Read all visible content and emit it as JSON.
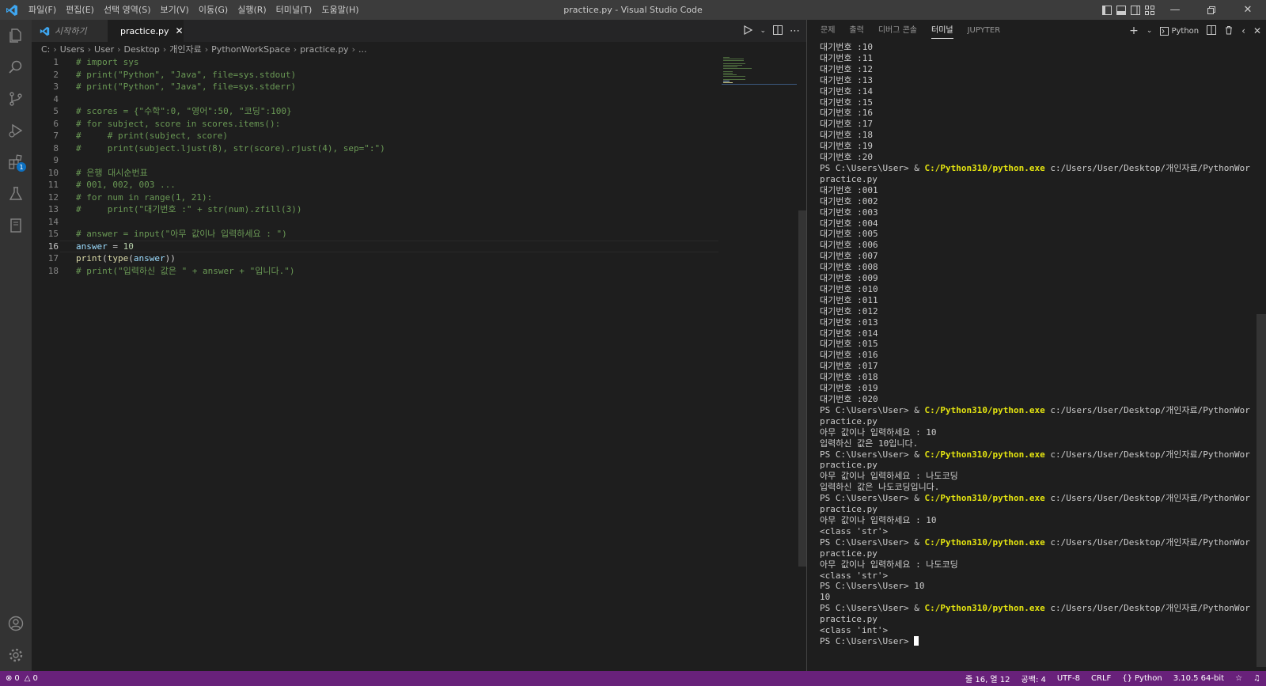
{
  "titlebar": {
    "menus": [
      "파일(F)",
      "편집(E)",
      "선택 영역(S)",
      "보기(V)",
      "이동(G)",
      "실행(R)",
      "터미널(T)",
      "도움말(H)"
    ],
    "title": "practice.py - Visual Studio Code"
  },
  "activitybar": {
    "extensions_badge": "1"
  },
  "tabs": [
    {
      "label": "시작하기"
    },
    {
      "label": "practice.py"
    }
  ],
  "breadcrumb": [
    "C:",
    "Users",
    "User",
    "Desktop",
    "개인자료",
    "PythonWorkSpace",
    "practice.py",
    "..."
  ],
  "code": {
    "current_line": 16,
    "lines": [
      "# import sys",
      "# print(\"Python\", \"Java\", file=sys.stdout)",
      "# print(\"Python\", \"Java\", file=sys.stderr)",
      "",
      "# scores = {\"수학\":0, \"영어\":50, \"코딩\":100}",
      "# for subject, score in scores.items():",
      "#     # print(subject, score)",
      "#     print(subject.ljust(8), str(score).rjust(4), sep=\":\")",
      "",
      "# 은행 대시순번표",
      "# 001, 002, 003 ...",
      "# for num in range(1, 21):",
      "#     print(\"대기번호 :\" + str(num).zfill(3))",
      "",
      "# answer = input(\"아무 값이나 입력하세요 : \")",
      "answer = 10",
      "print(type(answer))",
      "# print(\"입력하신 값은 \" + answer + \"입니다.\")"
    ]
  },
  "panel": {
    "tabs": [
      "문제",
      "출력",
      "디버그 콘솔",
      "터미널",
      "JUPYTER"
    ],
    "active_tab": "터미널",
    "shell_label": "Python"
  },
  "terminal": {
    "prompt": "PS C:\\Users\\User>",
    "amp": "&",
    "exe": "C:/Python310/python.exe",
    "script_path": "c:/Users/User/Desktop/개인자료/PythonWorkSpace/",
    "script_file": "practice.py",
    "lines": [
      {
        "t": "out",
        "text": "대기번호 :10"
      },
      {
        "t": "out",
        "text": "대기번호 :11"
      },
      {
        "t": "out",
        "text": "대기번호 :12"
      },
      {
        "t": "out",
        "text": "대기번호 :13"
      },
      {
        "t": "out",
        "text": "대기번호 :14"
      },
      {
        "t": "out",
        "text": "대기번호 :15"
      },
      {
        "t": "out",
        "text": "대기번호 :16"
      },
      {
        "t": "out",
        "text": "대기번호 :17"
      },
      {
        "t": "out",
        "text": "대기번호 :18"
      },
      {
        "t": "out",
        "text": "대기번호 :19"
      },
      {
        "t": "out",
        "text": "대기번호 :20"
      },
      {
        "t": "run"
      },
      {
        "t": "out",
        "text": "practice.py"
      },
      {
        "t": "out",
        "text": "대기번호 :001"
      },
      {
        "t": "out",
        "text": "대기번호 :002"
      },
      {
        "t": "out",
        "text": "대기번호 :003"
      },
      {
        "t": "out",
        "text": "대기번호 :004"
      },
      {
        "t": "out",
        "text": "대기번호 :005"
      },
      {
        "t": "out",
        "text": "대기번호 :006"
      },
      {
        "t": "out",
        "text": "대기번호 :007"
      },
      {
        "t": "out",
        "text": "대기번호 :008"
      },
      {
        "t": "out",
        "text": "대기번호 :009"
      },
      {
        "t": "out",
        "text": "대기번호 :010"
      },
      {
        "t": "out",
        "text": "대기번호 :011"
      },
      {
        "t": "out",
        "text": "대기번호 :012"
      },
      {
        "t": "out",
        "text": "대기번호 :013"
      },
      {
        "t": "out",
        "text": "대기번호 :014"
      },
      {
        "t": "out",
        "text": "대기번호 :015"
      },
      {
        "t": "out",
        "text": "대기번호 :016"
      },
      {
        "t": "out",
        "text": "대기번호 :017"
      },
      {
        "t": "out",
        "text": "대기번호 :018"
      },
      {
        "t": "out",
        "text": "대기번호 :019"
      },
      {
        "t": "out",
        "text": "대기번호 :020"
      },
      {
        "t": "run"
      },
      {
        "t": "out",
        "text": "practice.py"
      },
      {
        "t": "out",
        "text": "아무 값이나 입력하세요 : 10"
      },
      {
        "t": "out",
        "text": "입력하신 값은 10입니다."
      },
      {
        "t": "run"
      },
      {
        "t": "out",
        "text": "practice.py"
      },
      {
        "t": "out",
        "text": "아무 값이나 입력하세요 : 나도코딩"
      },
      {
        "t": "out",
        "text": "입력하신 값은 나도코딩입니다."
      },
      {
        "t": "run"
      },
      {
        "t": "out",
        "text": "practice.py"
      },
      {
        "t": "out",
        "text": "아무 값이나 입력하세요 : 10"
      },
      {
        "t": "out",
        "text": "<class 'str'>"
      },
      {
        "t": "run"
      },
      {
        "t": "out",
        "text": "practice.py"
      },
      {
        "t": "out",
        "text": "아무 값이나 입력하세요 : 나도코딩"
      },
      {
        "t": "out",
        "text": "<class 'str'>"
      },
      {
        "t": "cmd",
        "text": "10"
      },
      {
        "t": "out",
        "text": "10"
      },
      {
        "t": "run"
      },
      {
        "t": "out",
        "text": "practice.py"
      },
      {
        "t": "out",
        "text": "<class 'int'>"
      },
      {
        "t": "prompt"
      }
    ]
  },
  "statusbar": {
    "errors": "0",
    "warnings": "0",
    "position": "줄 16, 열 12",
    "spaces": "공백: 4",
    "encoding": "UTF-8",
    "eol": "CRLF",
    "language": "Python",
    "interpreter": "3.10.5 64-bit"
  },
  "colors": {
    "statusbar": "#68217a",
    "accent": "#0e70c0",
    "terminal_exe": "#e5e510"
  }
}
